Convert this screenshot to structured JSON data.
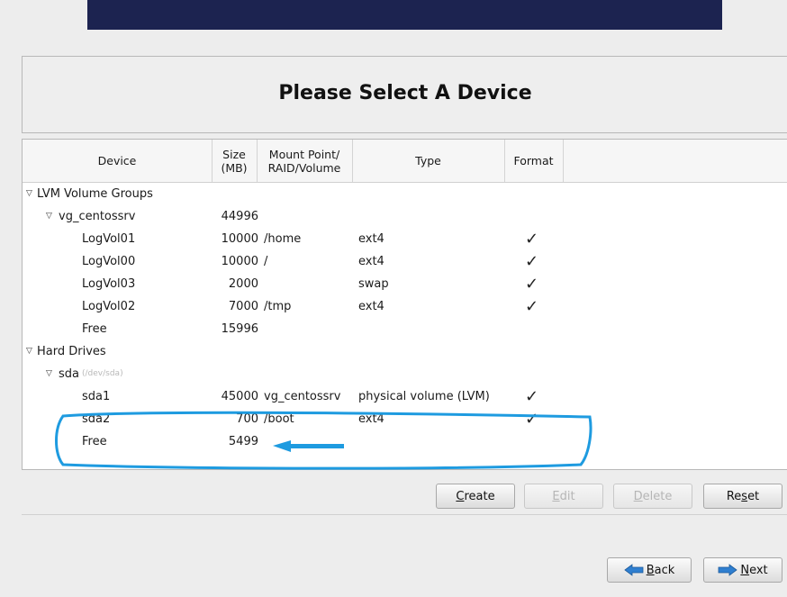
{
  "header": {
    "title": "Please Select A Device"
  },
  "table": {
    "columns": [
      "Device",
      "Size\n(MB)",
      "Mount Point/\nRAID/Volume",
      "Type",
      "Format"
    ],
    "rows": [
      {
        "indent": 0,
        "expander": true,
        "device": "LVM Volume Groups",
        "size": "",
        "mount": "",
        "type": "",
        "format": false
      },
      {
        "indent": 1,
        "expander": true,
        "device": "vg_centossrv",
        "size": "44996",
        "mount": "",
        "type": "",
        "format": false
      },
      {
        "indent": 2,
        "expander": false,
        "device": "LogVol01",
        "size": "10000",
        "mount": "/home",
        "type": "ext4",
        "format": true
      },
      {
        "indent": 2,
        "expander": false,
        "device": "LogVol00",
        "size": "10000",
        "mount": "/",
        "type": "ext4",
        "format": true
      },
      {
        "indent": 2,
        "expander": false,
        "device": "LogVol03",
        "size": "2000",
        "mount": "",
        "type": "swap",
        "format": true
      },
      {
        "indent": 2,
        "expander": false,
        "device": "LogVol02",
        "size": "7000",
        "mount": "/tmp",
        "type": "ext4",
        "format": true
      },
      {
        "indent": 2,
        "expander": false,
        "device": "Free",
        "size": "15996",
        "mount": "",
        "type": "",
        "format": false
      },
      {
        "indent": 0,
        "expander": true,
        "device": "Hard Drives",
        "size": "",
        "mount": "",
        "type": "",
        "format": false
      },
      {
        "indent": 1,
        "expander": true,
        "device": "sda",
        "hint": "(/dev/sda)",
        "size": "",
        "mount": "",
        "type": "",
        "format": false
      },
      {
        "indent": 2,
        "expander": false,
        "device": "sda1",
        "size": "45000",
        "mount": "vg_centossrv",
        "type": "physical volume (LVM)",
        "format": true
      },
      {
        "indent": 2,
        "expander": false,
        "device": "sda2",
        "size": "700",
        "mount": "/boot",
        "type": "ext4",
        "format": true
      },
      {
        "indent": 2,
        "expander": false,
        "device": "Free",
        "size": "5499",
        "mount": "",
        "type": "",
        "format": false
      }
    ]
  },
  "actions": {
    "create": {
      "pre": "",
      "key": "C",
      "post": "reate"
    },
    "edit": {
      "pre": "",
      "key": "E",
      "post": "dit"
    },
    "delete": {
      "pre": "",
      "key": "D",
      "post": "elete"
    },
    "reset": {
      "pre": "Re",
      "key": "s",
      "post": "et"
    }
  },
  "nav": {
    "back": {
      "pre": "",
      "key": "B",
      "post": "ack"
    },
    "next": {
      "pre": "",
      "key": "N",
      "post": "ext"
    }
  },
  "icons": {
    "expander": "triangle-down-icon",
    "format": "check-icon",
    "back": "arrow-left-icon",
    "next": "arrow-right-icon"
  },
  "colors": {
    "banner": "#1c2350",
    "annotation": "#1e9be0",
    "nav_arrow": "#2f7fd0"
  }
}
